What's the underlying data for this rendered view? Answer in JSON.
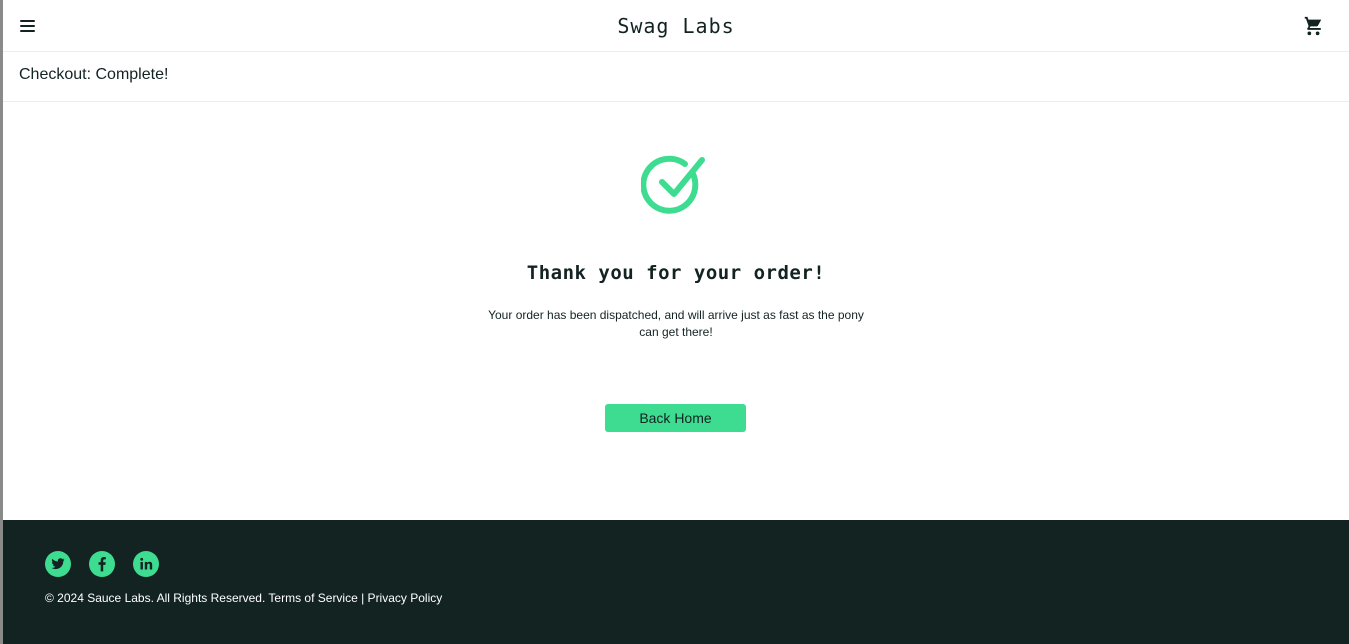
{
  "header": {
    "title": "Swag Labs",
    "menu_icon": "hamburger-menu-icon",
    "cart_icon": "shopping-cart-icon"
  },
  "subheader": {
    "title": "Checkout: Complete!"
  },
  "complete": {
    "icon": "checkmark-circle-icon",
    "heading": "Thank you for your order!",
    "text": "Your order has been dispatched, and will arrive just as fast as the pony can get there!",
    "back_button": "Back Home"
  },
  "footer": {
    "social": [
      "twitter-icon",
      "facebook-icon",
      "linkedin-icon"
    ],
    "copyright": "© 2024 Sauce Labs. All Rights Reserved. Terms of Service | Privacy Policy"
  },
  "colors": {
    "accent": "#3ddc91",
    "dark": "#132322",
    "border": "#ededed",
    "background": "#ffffff"
  }
}
